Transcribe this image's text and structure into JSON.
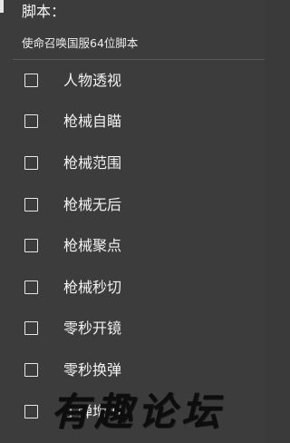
{
  "header": {
    "title": "脚本：",
    "subtitle": "使命召唤国服64位脚本"
  },
  "options": [
    {
      "label": "人物透视",
      "checked": false
    },
    {
      "label": "枪械自瞄",
      "checked": false
    },
    {
      "label": "枪械范围",
      "checked": false
    },
    {
      "label": "枪械无后",
      "checked": false
    },
    {
      "label": "枪械聚点",
      "checked": false
    },
    {
      "label": "枪械秒切",
      "checked": false
    },
    {
      "label": "零秒开镜",
      "checked": false
    },
    {
      "label": "零秒换弹",
      "checked": false
    },
    {
      "label": "子弹增加",
      "checked": false
    }
  ],
  "watermark": {
    "text": "有趣论坛"
  }
}
